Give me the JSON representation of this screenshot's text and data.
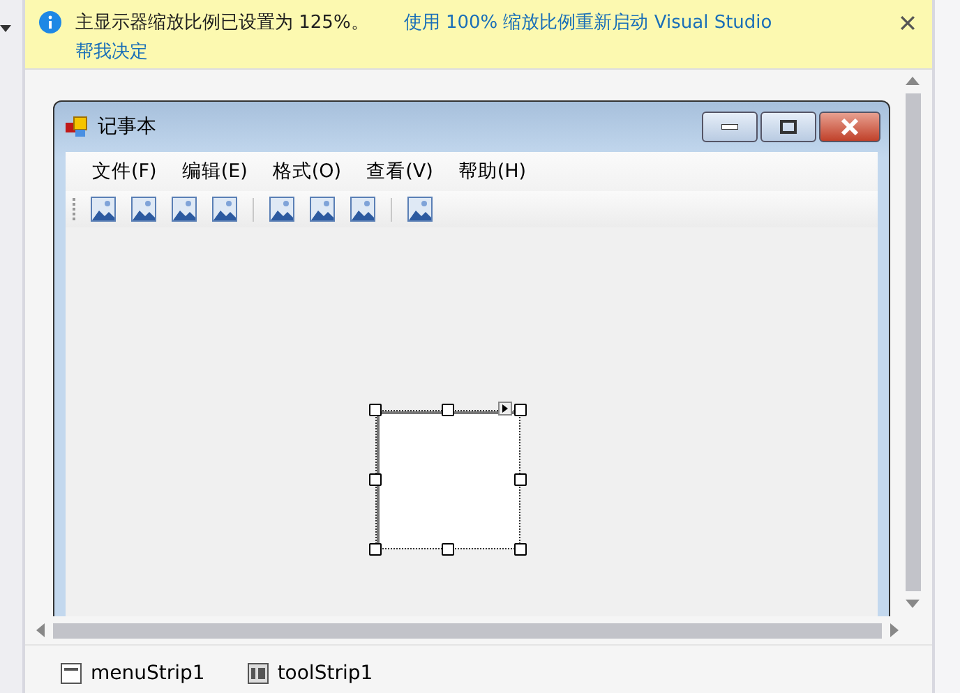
{
  "info_bar": {
    "message": "主显示器缩放比例已设置为 125%。",
    "action_link": "使用 100% 缩放比例重新启动 Visual Studio",
    "help_link": "帮我决定"
  },
  "form": {
    "title": "记事本",
    "menu": [
      "文件(F)",
      "编辑(E)",
      "格式(O)",
      "查看(V)",
      "帮助(H)"
    ],
    "toolbar": [
      {
        "kind": "button"
      },
      {
        "kind": "button"
      },
      {
        "kind": "button"
      },
      {
        "kind": "button"
      },
      {
        "kind": "separator"
      },
      {
        "kind": "button"
      },
      {
        "kind": "button"
      },
      {
        "kind": "button"
      },
      {
        "kind": "separator"
      },
      {
        "kind": "button"
      }
    ]
  },
  "tray": [
    {
      "label": "menuStrip1",
      "kind": "menu"
    },
    {
      "label": "toolStrip1",
      "kind": "toolstrip"
    }
  ]
}
